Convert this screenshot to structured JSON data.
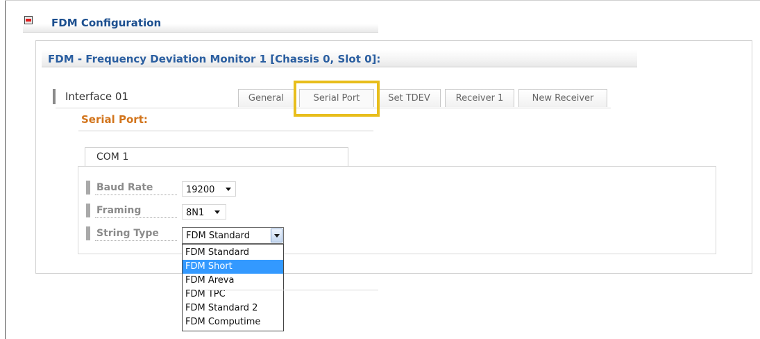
{
  "section": {
    "title": "FDM Configuration",
    "icon": "collapse-minus-icon"
  },
  "panel": {
    "title": "FDM - Frequency Deviation Monitor 1 [Chassis 0, Slot 0]:"
  },
  "interface": {
    "label": "Interface 01"
  },
  "tabs": [
    {
      "label": "General"
    },
    {
      "label": "Serial Port",
      "active": true
    },
    {
      "label": "Set TDEV"
    },
    {
      "label": "Receiver 1"
    },
    {
      "label": "New Receiver"
    }
  ],
  "serial_port": {
    "title": "Serial Port:",
    "com_label": "COM 1",
    "fields": {
      "baud_rate": {
        "label": "Baud Rate",
        "value": "19200"
      },
      "framing": {
        "label": "Framing",
        "value": "8N1"
      },
      "string_type": {
        "label": "String Type",
        "value": "FDM Standard",
        "options": [
          "FDM Standard",
          "FDM Short",
          "FDM Areva",
          "FDM TPC",
          "FDM Standard 2",
          "FDM Computime"
        ],
        "highlighted": "FDM Short"
      }
    }
  },
  "colors": {
    "section_title": "#1c4f8f",
    "panel_title": "#2a5ea0",
    "serial_title": "#d2741b",
    "tab_highlight": "#e8be1c",
    "dropdown_highlight": "#3399ff",
    "collapse_icon": "#e11b1b"
  }
}
